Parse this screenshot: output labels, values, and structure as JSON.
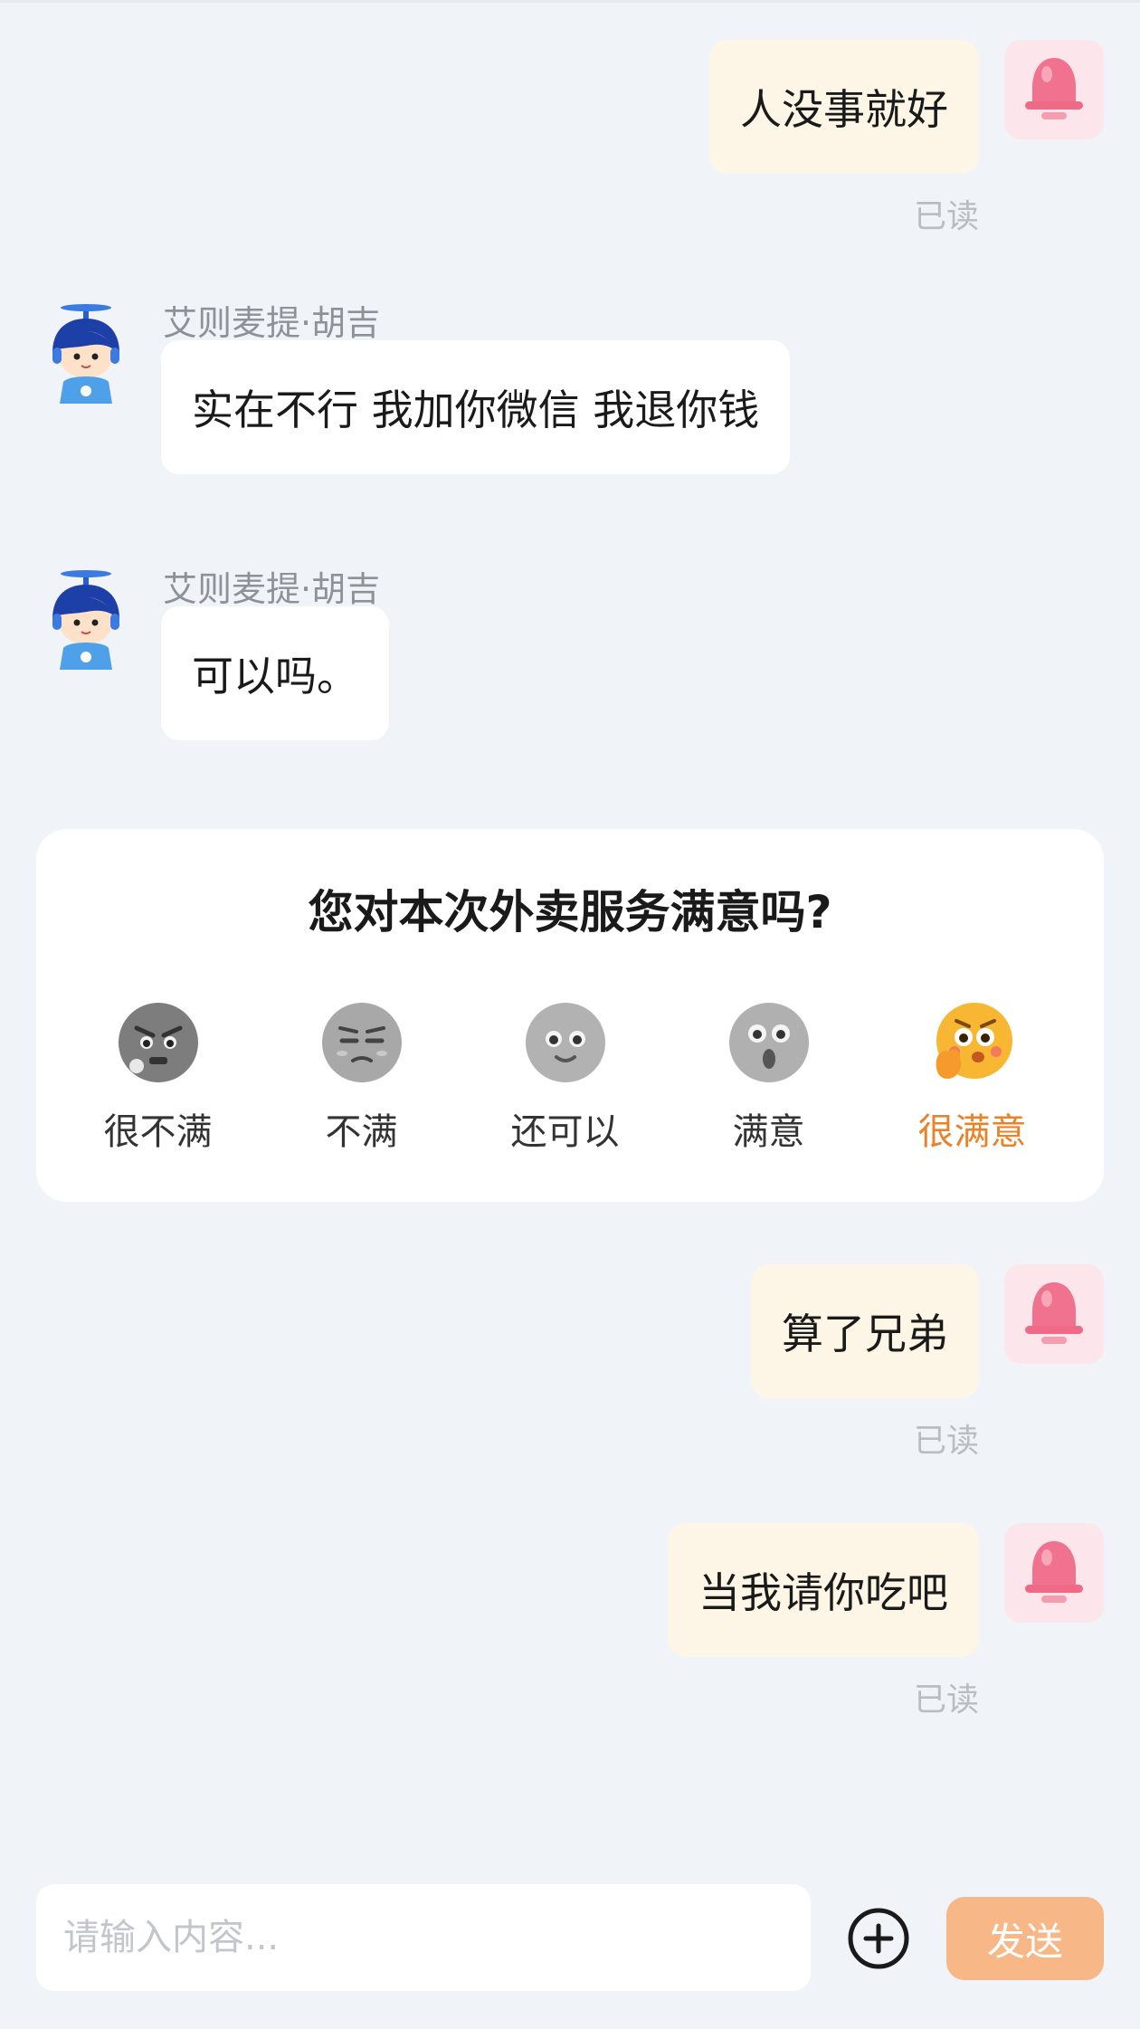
{
  "messages": [
    {
      "side": "out",
      "text": "人没事就好",
      "status": "已读"
    },
    {
      "side": "in",
      "sender": "艾则麦提·胡吉",
      "text": "实在不行 我加你微信 我退你钱"
    },
    {
      "side": "in",
      "sender": "艾则麦提·胡吉",
      "text": "可以吗。"
    },
    {
      "side": "out",
      "text": "算了兄弟",
      "status": "已读"
    },
    {
      "side": "out",
      "text": "当我请你吃吧",
      "status": "已读"
    }
  ],
  "rating": {
    "title": "您对本次外卖服务满意吗?",
    "options": [
      {
        "label": "很不满",
        "icon": "very-dissatisfied-face-icon"
      },
      {
        "label": "不满",
        "icon": "dissatisfied-face-icon"
      },
      {
        "label": "还可以",
        "icon": "neutral-face-icon"
      },
      {
        "label": "满意",
        "icon": "satisfied-face-icon"
      },
      {
        "label": "很满意",
        "icon": "very-satisfied-face-icon",
        "selected": true
      }
    ],
    "selected_color": "#e8832a"
  },
  "composer": {
    "placeholder": "请输入内容...",
    "send_label": "发送",
    "send_color": "#f8b787",
    "add_icon": "plus-circle-icon"
  },
  "colors": {
    "background": "#f0f4f8",
    "outgoing_bubble": "#fdf6e6",
    "incoming_bubble": "#ffffff"
  }
}
